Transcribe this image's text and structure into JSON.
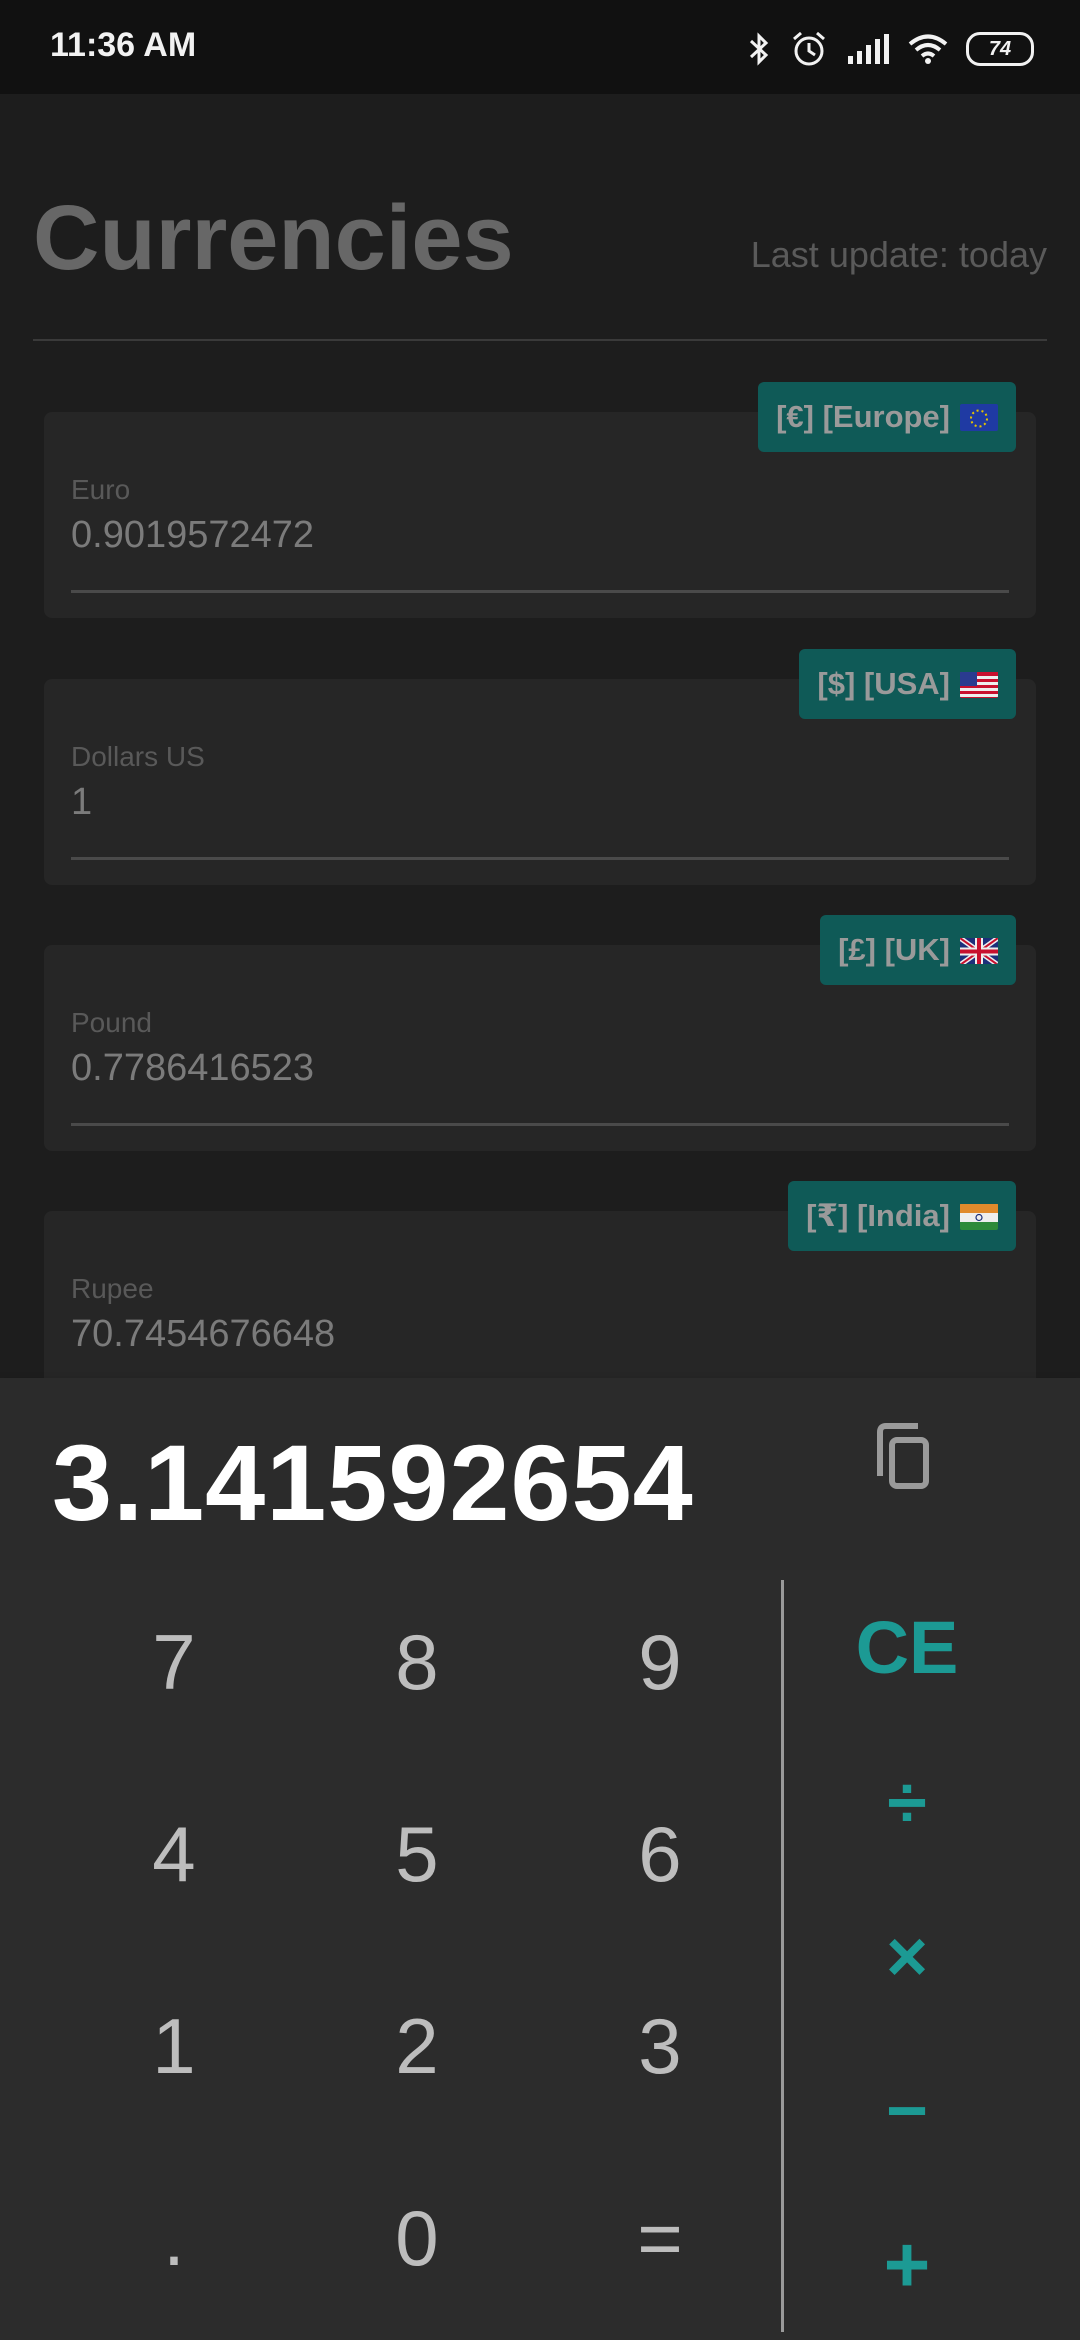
{
  "status_bar": {
    "time": "11:36 AM",
    "battery": "74",
    "icons": [
      "bluetooth-icon",
      "alarm-icon",
      "signal-icon",
      "wifi-icon",
      "battery-icon"
    ]
  },
  "header": {
    "title": "Currencies",
    "last_update": "Last update: today"
  },
  "currencies": [
    {
      "label": "Euro",
      "value": "0.9019572472",
      "badge": "[€] [Europe]",
      "flag": "eu"
    },
    {
      "label": "Dollars US",
      "value": "1",
      "badge": "[$] [USA]",
      "flag": "us"
    },
    {
      "label": "Pound",
      "value": "0.7786416523",
      "badge": "[£] [UK]",
      "flag": "uk"
    },
    {
      "label": "Rupee",
      "value": "70.7454676648",
      "badge": "[₹] [India]",
      "flag": "in"
    }
  ],
  "calculator": {
    "display": "3.141592654",
    "keys": [
      "7",
      "8",
      "9",
      "4",
      "5",
      "6",
      "1",
      "2",
      "3",
      ".",
      "0",
      "="
    ],
    "operators": [
      "CE",
      "÷",
      "×",
      "−",
      "+"
    ]
  },
  "colors": {
    "accent": "#1c9a94",
    "badge_bg": "#0f5a57",
    "background": "#1d1d1d",
    "keypad_bg": "#2c2c2c"
  }
}
